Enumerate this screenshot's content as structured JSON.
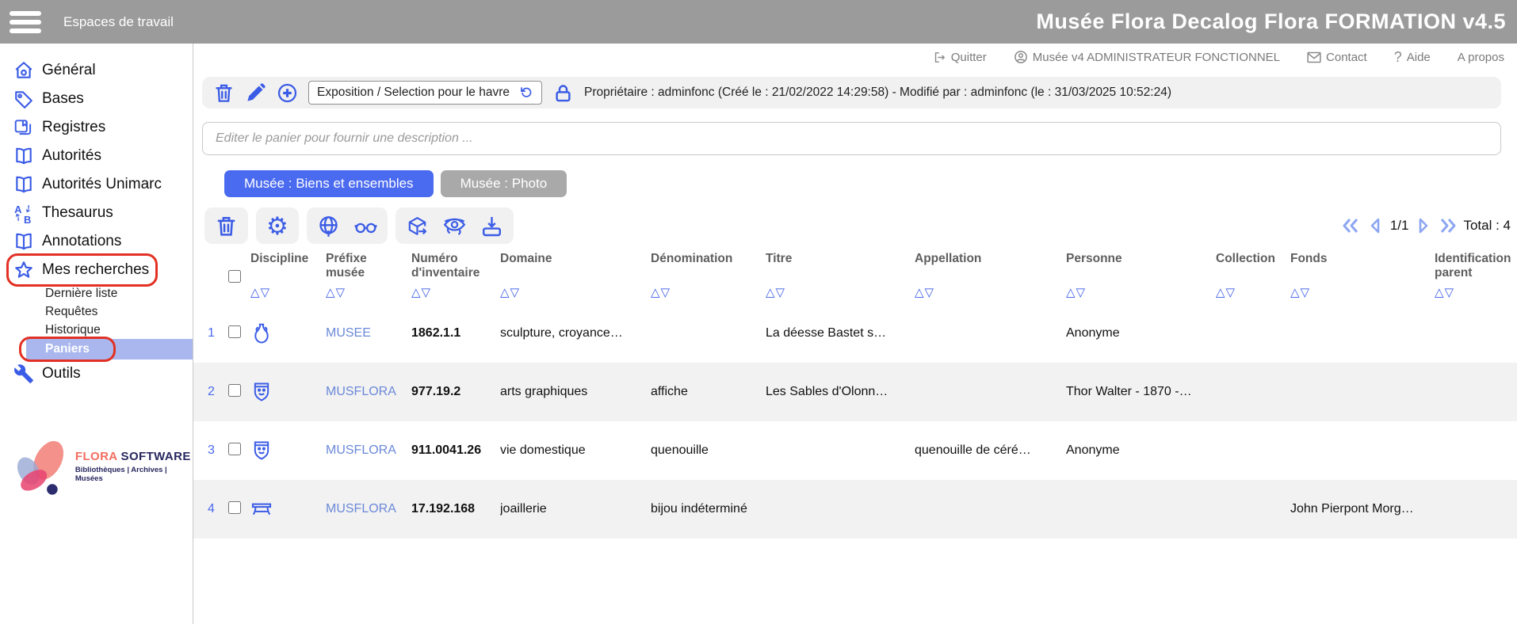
{
  "topbar": {
    "workspace": "Espaces de travail",
    "title": "Musée Flora Decalog Flora FORMATION v4.5"
  },
  "utility": {
    "quitter": "Quitter",
    "user": "Musée v4 ADMINISTRATEUR FONCTIONNEL",
    "contact": "Contact",
    "aide_mark": "?",
    "aide": "Aide",
    "apropos": "A propos"
  },
  "sidebar": {
    "items": [
      {
        "label": "Général"
      },
      {
        "label": "Bases"
      },
      {
        "label": "Registres"
      },
      {
        "label": "Autorités"
      },
      {
        "label": "Autorités Unimarc"
      },
      {
        "label": "Thesaurus"
      },
      {
        "label": "Annotations"
      },
      {
        "label": "Mes recherches"
      },
      {
        "label": "Outils"
      }
    ],
    "subitems": [
      {
        "label": "Dernière liste"
      },
      {
        "label": "Requêtes"
      },
      {
        "label": "Historique"
      },
      {
        "label": "Paniers"
      }
    ],
    "logo": {
      "brand_a": "FLORA",
      "brand_b": " SOFTWARE",
      "tagline": "Bibliothèques | Archives | Musées"
    }
  },
  "panier_bar": {
    "selector_value": "Exposition / Selection pour le havre",
    "metadata": "Propriétaire : adminfonc (Créé le : 21/02/2022 14:29:58) - Modifié par : adminfonc (le : 31/03/2025 10:52:24)"
  },
  "description": {
    "placeholder": "Editer le panier pour fournir une description ..."
  },
  "tabs": [
    {
      "label": "Musée : Biens et ensembles",
      "active": true
    },
    {
      "label": "Musée : Photo",
      "active": false
    }
  ],
  "pagination": {
    "page": "1/1",
    "total": "Total : 4"
  },
  "table": {
    "sort_glyphs": "△▽",
    "columns": [
      {
        "label": "Discipline"
      },
      {
        "label": "Préfixe\nmusée"
      },
      {
        "label": "Numéro\nd'inventaire"
      },
      {
        "label": "Domaine"
      },
      {
        "label": "Dénomination"
      },
      {
        "label": "Titre"
      },
      {
        "label": "Appellation"
      },
      {
        "label": "Personne"
      },
      {
        "label": "Collection"
      },
      {
        "label": "Fonds"
      },
      {
        "label": "Identification\nparent"
      }
    ],
    "rows": [
      {
        "num": "1",
        "discipline_icon": "amphora-icon",
        "prefixe": "MUSEE",
        "numero": "1862.1.1",
        "domaine": "sculpture, croyance…",
        "denomination": "",
        "titre": "La déesse Bastet s…",
        "appellation": "",
        "personne": "Anonyme",
        "collection": "",
        "fonds": "",
        "identification": ""
      },
      {
        "num": "2",
        "discipline_icon": "crest-icon",
        "prefixe": "MUSFLORA",
        "numero": "977.19.2",
        "domaine": "arts graphiques",
        "denomination": "affiche",
        "titre": "Les Sables d'Olonn…",
        "appellation": "",
        "personne": "Thor Walter - 1870 -…",
        "collection": "",
        "fonds": "",
        "identification": ""
      },
      {
        "num": "3",
        "discipline_icon": "crest-icon",
        "prefixe": "MUSFLORA",
        "numero": "911.0041.26",
        "domaine": "vie domestique",
        "denomination": "quenouille",
        "titre": "",
        "appellation": "quenouille de céré…",
        "personne": "Anonyme",
        "collection": "",
        "fonds": "",
        "identification": ""
      },
      {
        "num": "4",
        "discipline_icon": "table-icon",
        "prefixe": "MUSFLORA",
        "numero": "17.192.168",
        "domaine": "joaillerie",
        "denomination": "bijou indéterminé",
        "titre": "",
        "appellation": "",
        "personne": "",
        "collection": "",
        "fonds": "John Pierpont Morg…",
        "identification": ""
      }
    ]
  },
  "colors": {
    "accent_blue": "#3b5ce6",
    "tab_active": "#4a6af0",
    "tab_inactive": "#a9a9a9",
    "selected_row_bg": "#a9b7ee",
    "annotation_red": "#e23124",
    "link_blue": "#6b89d8",
    "topbar_gray": "#9b9b9b"
  }
}
